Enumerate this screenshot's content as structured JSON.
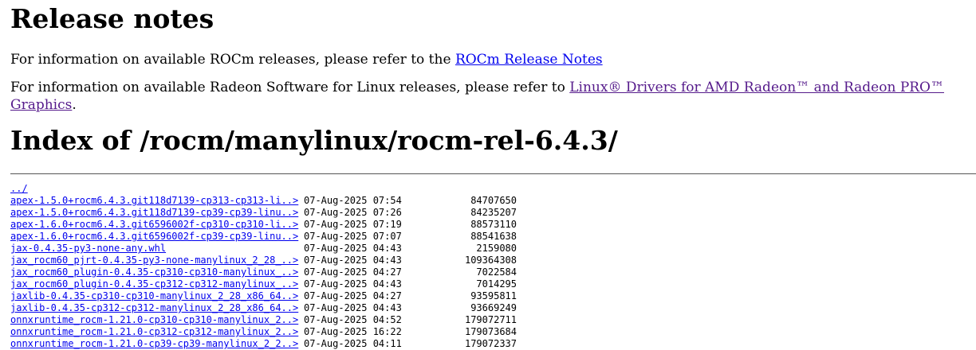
{
  "release_notes": {
    "heading": "Release notes",
    "rocm_text": "For information on available ROCm releases, please refer to the ",
    "rocm_link": "ROCm Release Notes",
    "radeon_text": "For information on available Radeon Software for Linux releases, please refer to ",
    "radeon_link": "Linux® Drivers for AMD Radeon™ and Radeon PRO™ Graphics",
    "radeon_suffix": "."
  },
  "index": {
    "heading": "Index of /rocm/manylinux/rocm-rel-6.4.3/",
    "parent_link": "../",
    "files": [
      {
        "name": "apex-1.5.0+rocm6.4.3.git118d7139-cp313-cp313-li..>",
        "date": "07-Aug-2025 07:54",
        "size": "84707650"
      },
      {
        "name": "apex-1.5.0+rocm6.4.3.git118d7139-cp39-cp39-linu..>",
        "date": "07-Aug-2025 07:26",
        "size": "84235207"
      },
      {
        "name": "apex-1.6.0+rocm6.4.3.git6596002f-cp310-cp310-li..>",
        "date": "07-Aug-2025 07:19",
        "size": "88573110"
      },
      {
        "name": "apex-1.6.0+rocm6.4.3.git6596002f-cp39-cp39-linu..>",
        "date": "07-Aug-2025 07:07",
        "size": "88541638"
      },
      {
        "name": "jax-0.4.35-py3-none-any.whl",
        "date": "07-Aug-2025 04:43",
        "size": "2159080"
      },
      {
        "name": "jax_rocm60_pjrt-0.4.35-py3-none-manylinux_2_28_..>",
        "date": "07-Aug-2025 04:43",
        "size": "109364308"
      },
      {
        "name": "jax_rocm60_plugin-0.4.35-cp310-cp310-manylinux_..>",
        "date": "07-Aug-2025 04:27",
        "size": "7022584"
      },
      {
        "name": "jax_rocm60_plugin-0.4.35-cp312-cp312-manylinux_..>",
        "date": "07-Aug-2025 04:43",
        "size": "7014295"
      },
      {
        "name": "jaxlib-0.4.35-cp310-cp310-manylinux_2_28_x86_64..>",
        "date": "07-Aug-2025 04:27",
        "size": "93595811"
      },
      {
        "name": "jaxlib-0.4.35-cp312-cp312-manylinux_2_28_x86_64..>",
        "date": "07-Aug-2025 04:43",
        "size": "93669249"
      },
      {
        "name": "onnxruntime_rocm-1.21.0-cp310-cp310-manylinux_2..>",
        "date": "07-Aug-2025 04:52",
        "size": "179072711"
      },
      {
        "name": "onnxruntime_rocm-1.21.0-cp312-cp312-manylinux_2..>",
        "date": "07-Aug-2025 16:22",
        "size": "179073684"
      },
      {
        "name": "onnxruntime_rocm-1.21.0-cp39-cp39-manylinux_2_2..>",
        "date": "07-Aug-2025 04:11",
        "size": "179072337"
      }
    ]
  }
}
